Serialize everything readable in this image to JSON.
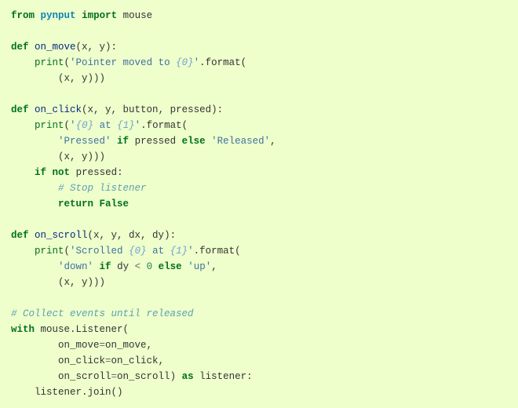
{
  "code": {
    "kw_from": "from",
    "mod_pynput": "pynput",
    "kw_import": "import",
    "name_mouse": "mouse",
    "kw_def": "def",
    "fn_on_move": "on_move",
    "params_on_move": "(x, y):",
    "bn_print": "print",
    "str_pointer_moved_a": "'Pointer moved to ",
    "si_0": "{0}",
    "str_pointer_moved_b": "'",
    "dot_format": ".format(",
    "tuple_xy": "(x, y)))",
    "fn_on_click": "on_click",
    "params_on_click": "(x, y, button, pressed):",
    "str_click_a": "'",
    "str_click_b": " at ",
    "si_1": "{1}",
    "str_click_c": "'",
    "str_pressed": "'Pressed'",
    "kw_if": "if",
    "name_pressed": "pressed",
    "kw_else": "else",
    "str_released": "'Released'",
    "comma": ",",
    "tuple_xy2": "(x, y)))",
    "kw_not": "not",
    "name_pressed2": "pressed:",
    "comment_stop": "# Stop listener",
    "kw_return": "return",
    "const_false": "False",
    "fn_on_scroll": "on_scroll",
    "params_on_scroll": "(x, y, dx, dy):",
    "str_scrolled_a": "'Scrolled ",
    "str_scrolled_b": " at ",
    "str_scrolled_c": "'",
    "str_down": "'down'",
    "name_dy": "dy",
    "op_lt": "<",
    "num_zero": "0",
    "str_up": "'up'",
    "tuple_xy3": "(x, y)))",
    "comment_collect": "# Collect events until released",
    "kw_with": "with",
    "listener_call": "mouse.Listener(",
    "arg_on_move": "on_move",
    "eq": "=",
    "arg_on_click": "on_click",
    "arg_on_scroll": "on_scroll",
    "close_paren": ")",
    "kw_as": "as",
    "name_listener": "listener:",
    "join_line": "listener.join()"
  }
}
